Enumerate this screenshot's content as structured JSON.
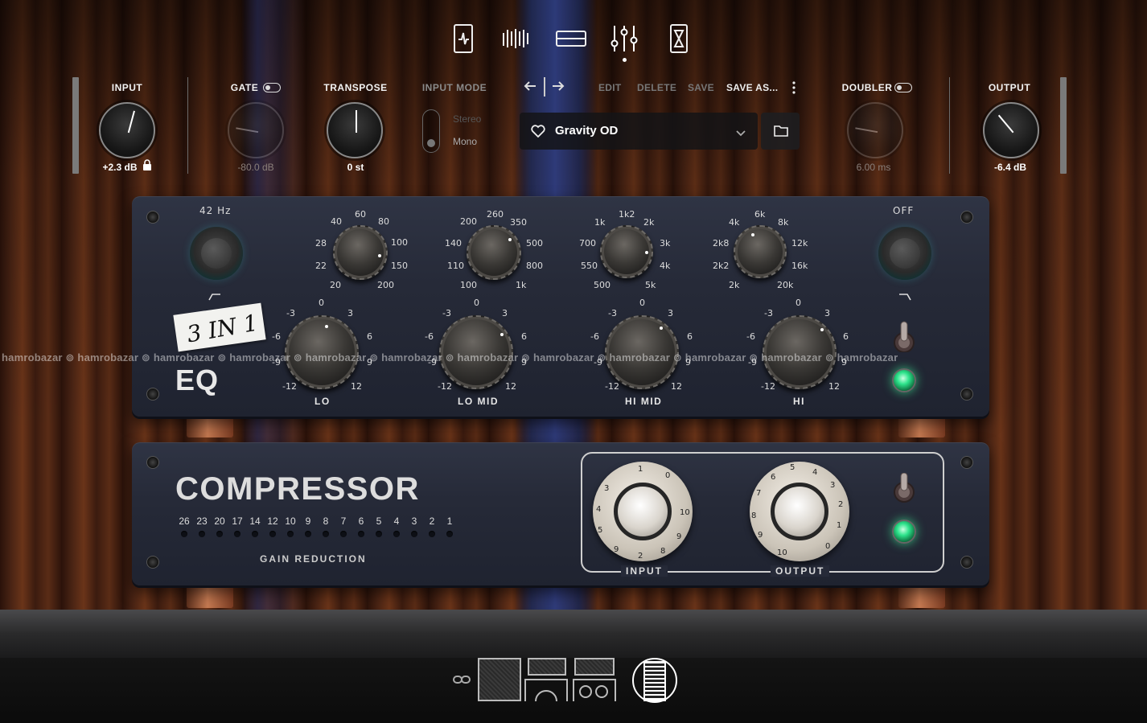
{
  "nav": {
    "icons": [
      "tuner-icon",
      "rhythm-icon",
      "rack-view-icon",
      "mixer-icon",
      "timer-icon"
    ],
    "active": "mixer-icon"
  },
  "header": {
    "input": {
      "label": "INPUT",
      "value": "+2.3 dB"
    },
    "gate": {
      "label": "GATE",
      "value": "-80.0 dB"
    },
    "transpose": {
      "label": "TRANSPOSE",
      "value": "0 st"
    },
    "input_mode": {
      "label": "INPUT MODE",
      "options": [
        "Stereo",
        "Mono"
      ],
      "selected": "Mono"
    },
    "preset_menu": {
      "edit": "EDIT",
      "delete": "DELETE",
      "save": "SAVE",
      "save_as": "SAVE AS..."
    },
    "preset_name": "Gravity OD",
    "doubler": {
      "label": "DOUBLER",
      "value": "6.00 ms"
    },
    "output": {
      "label": "OUTPUT",
      "value": "-6.4 dB"
    }
  },
  "eq": {
    "hpf_label": "42 Hz",
    "lpf_label": "OFF",
    "sticker": "3 IN 1",
    "title": "EQ",
    "freq_knobs": [
      {
        "ticks": [
          "20",
          "22",
          "28",
          "40",
          "60",
          "80",
          "100",
          "150",
          "200"
        ]
      },
      {
        "ticks": [
          "100",
          "110",
          "140",
          "200",
          "260",
          "350",
          "500",
          "800",
          "1k"
        ]
      },
      {
        "ticks": [
          "500",
          "550",
          "700",
          "1k",
          "1k2",
          "2k",
          "3k",
          "4k",
          "5k"
        ]
      },
      {
        "ticks": [
          "2k",
          "2k2",
          "2k8",
          "4k",
          "6k",
          "8k",
          "12k",
          "16k",
          "20k"
        ]
      }
    ],
    "gain_ticks": [
      "-12",
      "-9",
      "-6",
      "-3",
      "0",
      "3",
      "6",
      "9",
      "12"
    ],
    "bands": [
      "LO",
      "LO MID",
      "HI MID",
      "HI"
    ]
  },
  "compressor": {
    "title": "COMPRESSOR",
    "gr_scale": [
      "26",
      "23",
      "20",
      "17",
      "14",
      "12",
      "10",
      "9",
      "8",
      "7",
      "6",
      "5",
      "4",
      "3",
      "2",
      "1"
    ],
    "gr_label": "GAIN REDUCTION",
    "input_label": "INPUT",
    "output_label": "OUTPUT",
    "dial_ticks": [
      "0",
      "1",
      "2",
      "3",
      "4",
      "5",
      "6",
      "7",
      "8",
      "9",
      "10"
    ]
  },
  "watermark": "hamrobazar",
  "colors": {
    "led_green": "#2de38b",
    "rack_panel": "#2a2e3c",
    "accent_white": "#ffffff"
  }
}
